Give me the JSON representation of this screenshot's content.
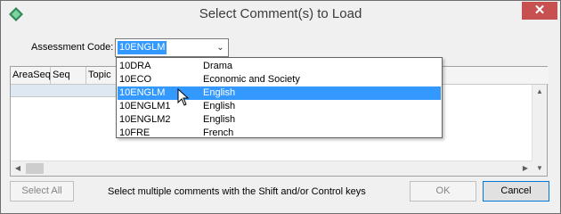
{
  "window": {
    "title": "Select Comment(s) to Load",
    "close_glyph": "✕",
    "icon": "app-diamond-icon"
  },
  "assessment": {
    "label": "Assessment Code:",
    "value": "10ENGLM",
    "arrow_glyph": "⌄"
  },
  "grid": {
    "columns": [
      "AreaSeq",
      "Seq",
      "Topic"
    ]
  },
  "dropdown": {
    "items": [
      {
        "code": "10DRA",
        "name": "Drama",
        "selected": false
      },
      {
        "code": "10ECO",
        "name": "Economic and Society",
        "selected": false
      },
      {
        "code": "10ENGLM",
        "name": "English",
        "selected": true
      },
      {
        "code": "10ENGLM1",
        "name": "English",
        "selected": false
      },
      {
        "code": "10ENGLM2",
        "name": "English",
        "selected": false
      },
      {
        "code": "10FRE",
        "name": "French",
        "selected": false
      }
    ]
  },
  "footer": {
    "select_all": "Select All",
    "hint": "Select multiple comments with the Shift and/or Control keys",
    "ok": "OK",
    "cancel": "Cancel"
  },
  "colors": {
    "selection": "#3399ff",
    "close_button": "#c75050",
    "focus_border": "#0078d7"
  }
}
